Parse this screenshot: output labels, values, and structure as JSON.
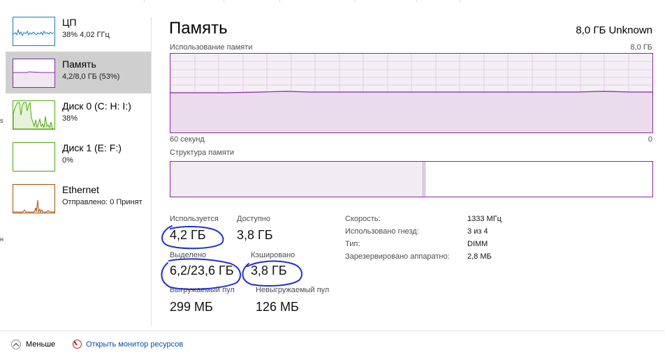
{
  "sidebar": {
    "items": [
      {
        "title": "ЦП",
        "sub": "38% 4,02 ГГц",
        "color": "#117dbb"
      },
      {
        "title": "Память",
        "sub": "4,2/8,0 ГБ (53%)",
        "color": "#8b24a8"
      },
      {
        "title": "Диск 0 (C: H: I:)",
        "sub": "38%",
        "color": "#4da60c"
      },
      {
        "title": "Диск 1 (E: F:)",
        "sub": "0%",
        "color": "#4da60c"
      },
      {
        "title": "Ethernet",
        "sub": "Отправлено: 0 Принят",
        "color": "#a74f01"
      }
    ]
  },
  "main": {
    "title": "Память",
    "capacity": "8,0 ГБ Unknown",
    "usage_label": "Использование памяти",
    "usage_max": "8,0 ГБ",
    "time_left": "60 секунд",
    "time_right": "0",
    "structure_label": "Структура памяти"
  },
  "stats": {
    "in_use_label": "Используется",
    "in_use_value": "4,2 ГБ",
    "available_label": "Доступно",
    "available_value": "3,8 ГБ",
    "committed_label": "Выделено",
    "committed_value": "6,2/23,6 ГБ",
    "cached_label": "Кэшировано",
    "cached_value": "3,8 ГБ",
    "paged_label": "Выгружаемый пул",
    "paged_value": "299 МБ",
    "nonpaged_label": "Невыгружаемый пул",
    "nonpaged_value": "126 МБ"
  },
  "details": [
    {
      "key": "Скорость:",
      "value": "1333 МГц"
    },
    {
      "key": "Использовано гнезд:",
      "value": "3 из 4"
    },
    {
      "key": "Тип:",
      "value": "DIMM"
    },
    {
      "key": "Зарезервировано аппаратно:",
      "value": "2,8 МБ"
    }
  ],
  "footer": {
    "less_label": "Меньше",
    "monitor_label": "Открыть монитор ресурсов"
  },
  "edge_marks": [
    "s",
    "н"
  ],
  "colors": {
    "memory": "#8b24a8",
    "ink": "#1f2fd6",
    "link": "#0b4fa8"
  }
}
